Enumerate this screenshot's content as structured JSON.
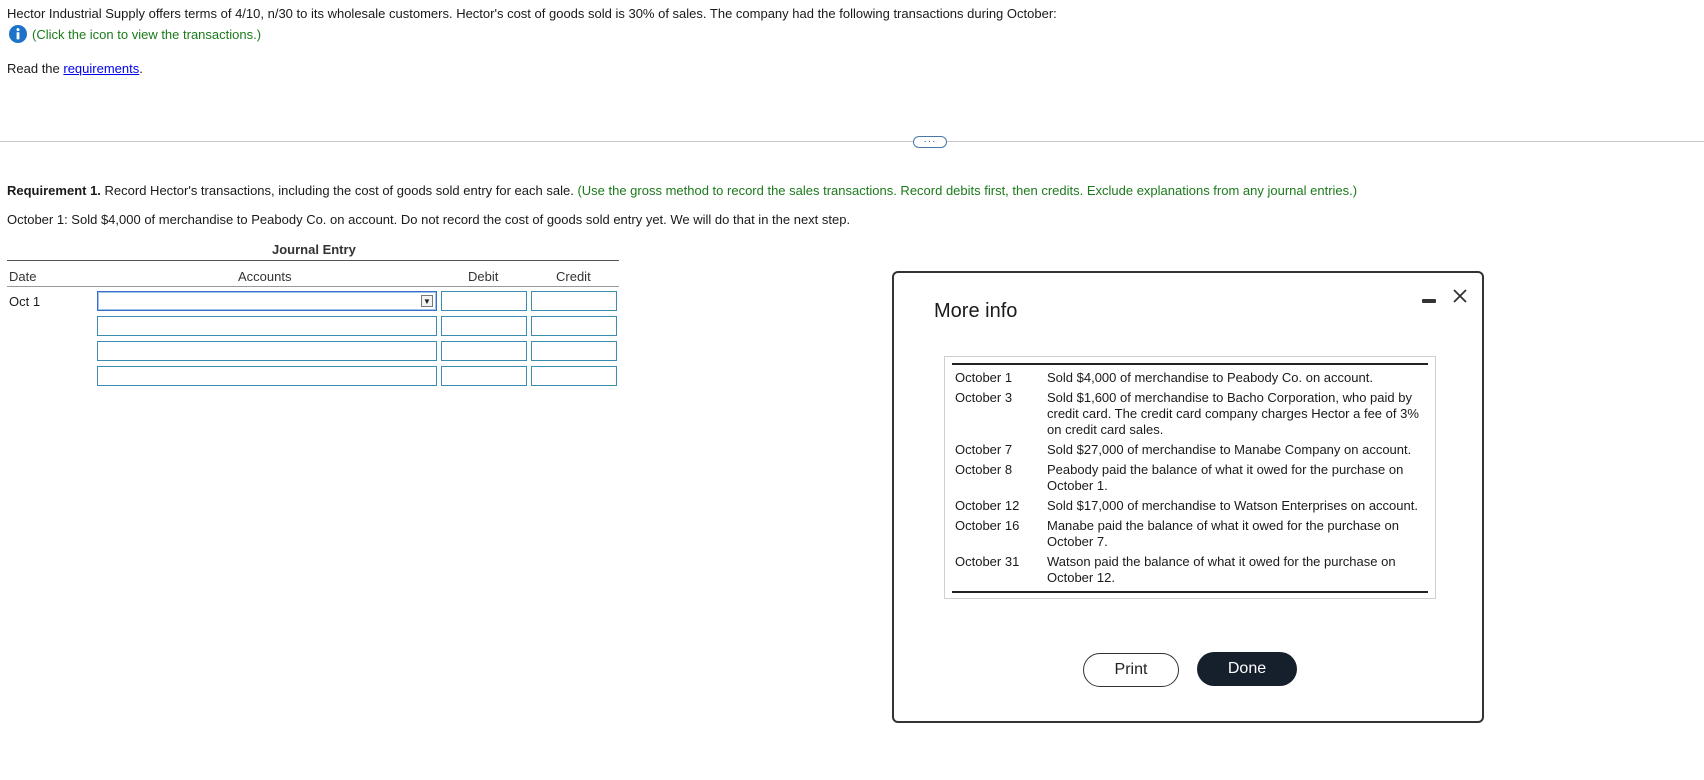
{
  "intro": {
    "text": "Hector Industrial Supply offers terms of 4/10, n/30 to its wholesale customers. Hector's cost of goods sold is 30% of sales. The company had the following transactions during October:",
    "click_text": "(Click the icon to view the transactions.)",
    "read_prefix": "Read the ",
    "requirements_link": "requirements",
    "read_suffix": "."
  },
  "collapse_label": "···",
  "requirement": {
    "label": "Requirement 1.",
    "text": " Record Hector's transactions, including the cost of goods sold entry for each sale. ",
    "note": "(Use the gross method to record the sales transactions. Record debits first, then credits. Exclude explanations from any journal entries.)"
  },
  "step_text": "October 1: Sold $4,000 of merchandise to Peabody Co. on account. Do not record the cost of goods sold entry yet. We will do that in the next step.",
  "journal": {
    "title": "Journal Entry",
    "headers": {
      "date": "Date",
      "accounts": "Accounts",
      "debit": "Debit",
      "credit": "Credit"
    },
    "date_value": "Oct 1",
    "rows": [
      {
        "account": "",
        "debit": "",
        "credit": ""
      },
      {
        "account": "",
        "debit": "",
        "credit": ""
      },
      {
        "account": "",
        "debit": "",
        "credit": ""
      },
      {
        "account": "",
        "debit": "",
        "credit": ""
      }
    ]
  },
  "modal": {
    "title": "More info",
    "transactions": [
      {
        "date": "October 1",
        "desc": "Sold $4,000 of merchandise to Peabody Co. on account."
      },
      {
        "date": "October 3",
        "desc": "Sold $1,600 of merchandise to Bacho Corporation, who paid by credit card. The credit card company charges Hector a fee of 3% on credit card sales."
      },
      {
        "date": "October 7",
        "desc": "Sold $27,000 of merchandise to Manabe Company on account."
      },
      {
        "date": "October 8",
        "desc": "Peabody paid the balance of what it owed for the purchase on October 1."
      },
      {
        "date": "October 12",
        "desc": "Sold $17,000 of merchandise to Watson Enterprises on account."
      },
      {
        "date": "October 16",
        "desc": "Manabe paid the balance of what it owed for the purchase on October 7."
      },
      {
        "date": "October 31",
        "desc": "Watson paid the balance of what it owed for the purchase on October 12."
      }
    ],
    "print_label": "Print",
    "done_label": "Done"
  },
  "icons": {
    "info": "info-icon",
    "minimize": "minimize-icon",
    "close": "close-icon",
    "dropdown": "dropdown-arrow-icon"
  },
  "colors": {
    "accent_green": "#1b7a1b",
    "info_blue": "#1e73c8",
    "done_bg": "#16202c",
    "input_border": "#3a8cb0"
  }
}
